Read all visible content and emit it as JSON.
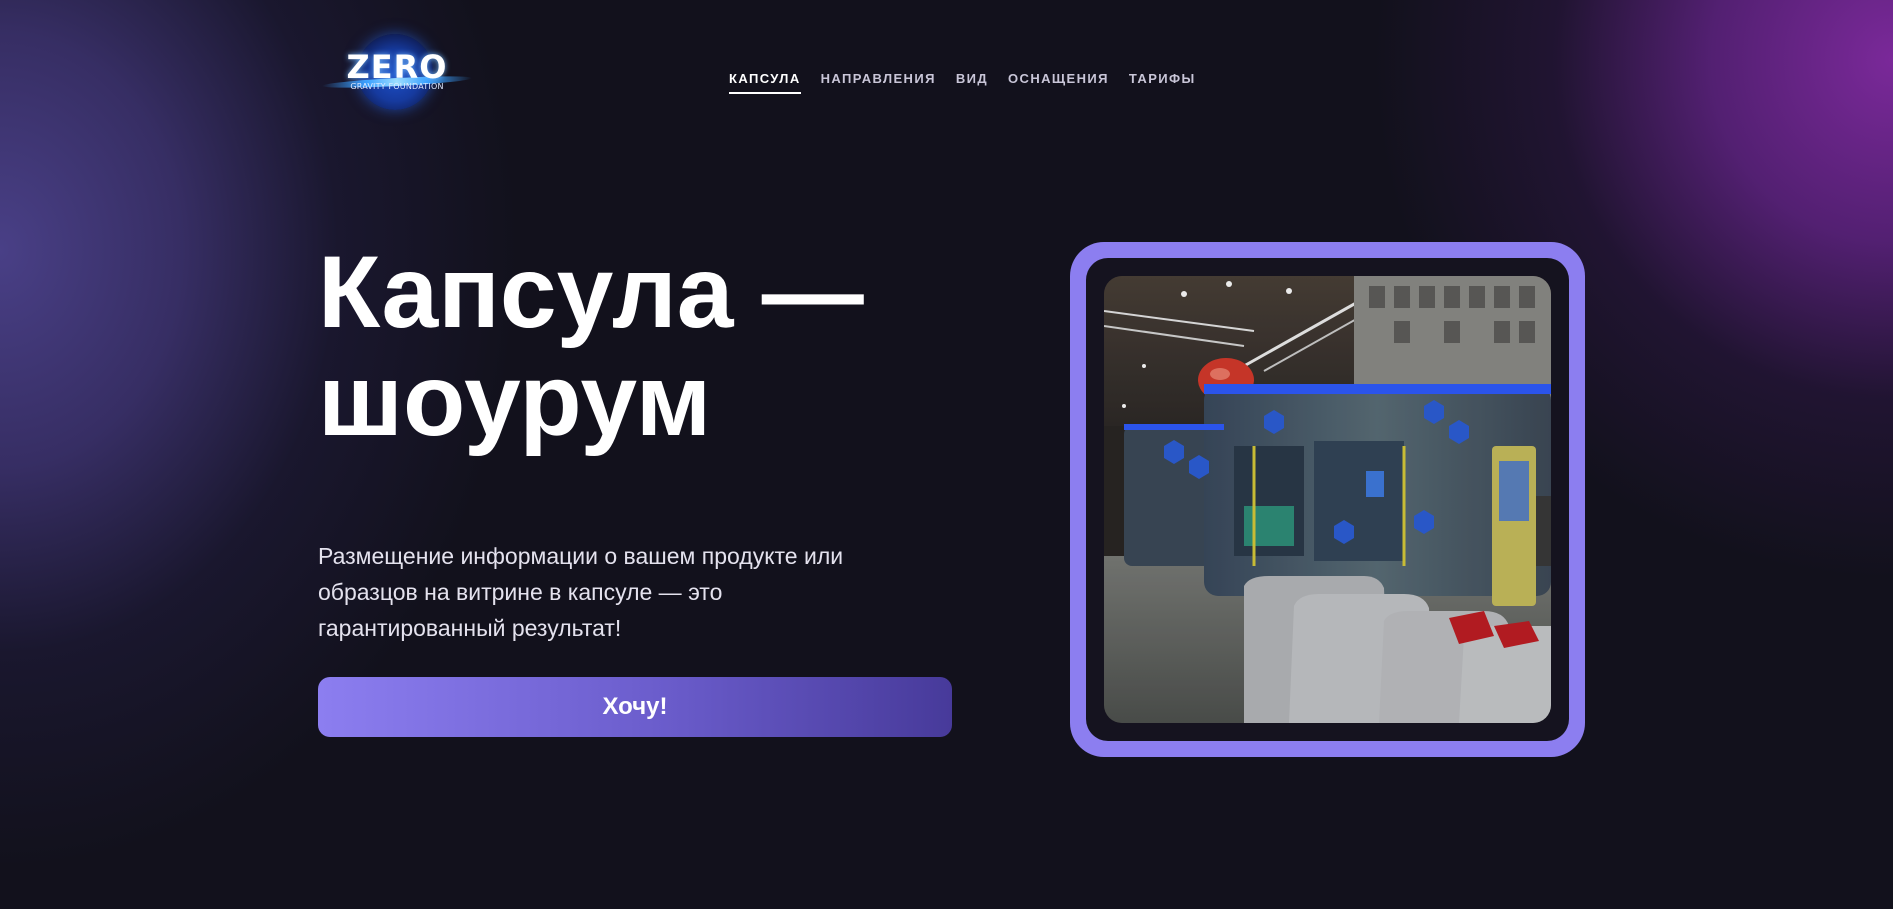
{
  "logo": {
    "title": "ZERO",
    "subtitle": "GRAVITY FOUNDATION"
  },
  "nav": {
    "items": [
      {
        "label": "КАПСУЛА",
        "active": true
      },
      {
        "label": "НАПРАВЛЕНИЯ",
        "active": false
      },
      {
        "label": "ВИД",
        "active": false
      },
      {
        "label": "ОСНАЩЕНИЯ",
        "active": false
      },
      {
        "label": "ТАРИФЫ",
        "active": false
      }
    ]
  },
  "hero": {
    "title_line1": "Капсула —",
    "title_line2": "шоурум",
    "description": "Размещение информации о вашем продукте или образцов на витрине в капсуле — это гарантированный результат!",
    "cta_label": "Хочу!"
  },
  "colors": {
    "background": "#12111c",
    "accent": "#8c7ef0",
    "accent_dark": "#473a9a",
    "text": "#ffffff"
  }
}
